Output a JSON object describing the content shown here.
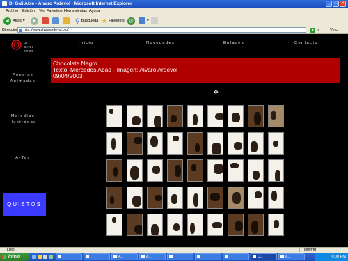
{
  "window": {
    "title": "Di Gali Atxe - Alvaro Ardevol - Microsoft Internet Explorer"
  },
  "menu": [
    "Archivo",
    "Edición",
    "Ver",
    "Favoritos",
    "Herramientas",
    "Ayuda"
  ],
  "toolbar": {
    "back": "Atrás",
    "search": "Búsqueda",
    "favorites": "Favoritos"
  },
  "address": {
    "label": "Dirección",
    "url": "http://www.alvaroardevol.org/",
    "go": "Ir",
    "links": "Vínc."
  },
  "site": {
    "logo_lines": [
      "DI",
      "GALI",
      "ATXE"
    ],
    "nav": [
      "Inicio",
      "Novedades",
      "Enlaces",
      "Contacto"
    ],
    "side": [
      {
        "lines": [
          "Poesías",
          "Animadas"
        ]
      },
      {
        "lines": [
          "Melodías",
          "Ilustradas"
        ]
      },
      {
        "lines": [
          "A-Tex"
        ]
      }
    ],
    "quietos": "QUIETOS",
    "banner": {
      "title": "Chocolate Negro",
      "credits": "Texto: Mercedes Abad - Imagen: Alvaro Ardevol",
      "date": "09/04/2003"
    }
  },
  "status": {
    "left": "Listo",
    "zone": "Internet"
  },
  "taskbar": {
    "start": "Inicio",
    "tasks": [
      "",
      "",
      "A...",
      "A...",
      "",
      "",
      "",
      "D...",
      "A..."
    ],
    "clock": "6:00 PM"
  }
}
